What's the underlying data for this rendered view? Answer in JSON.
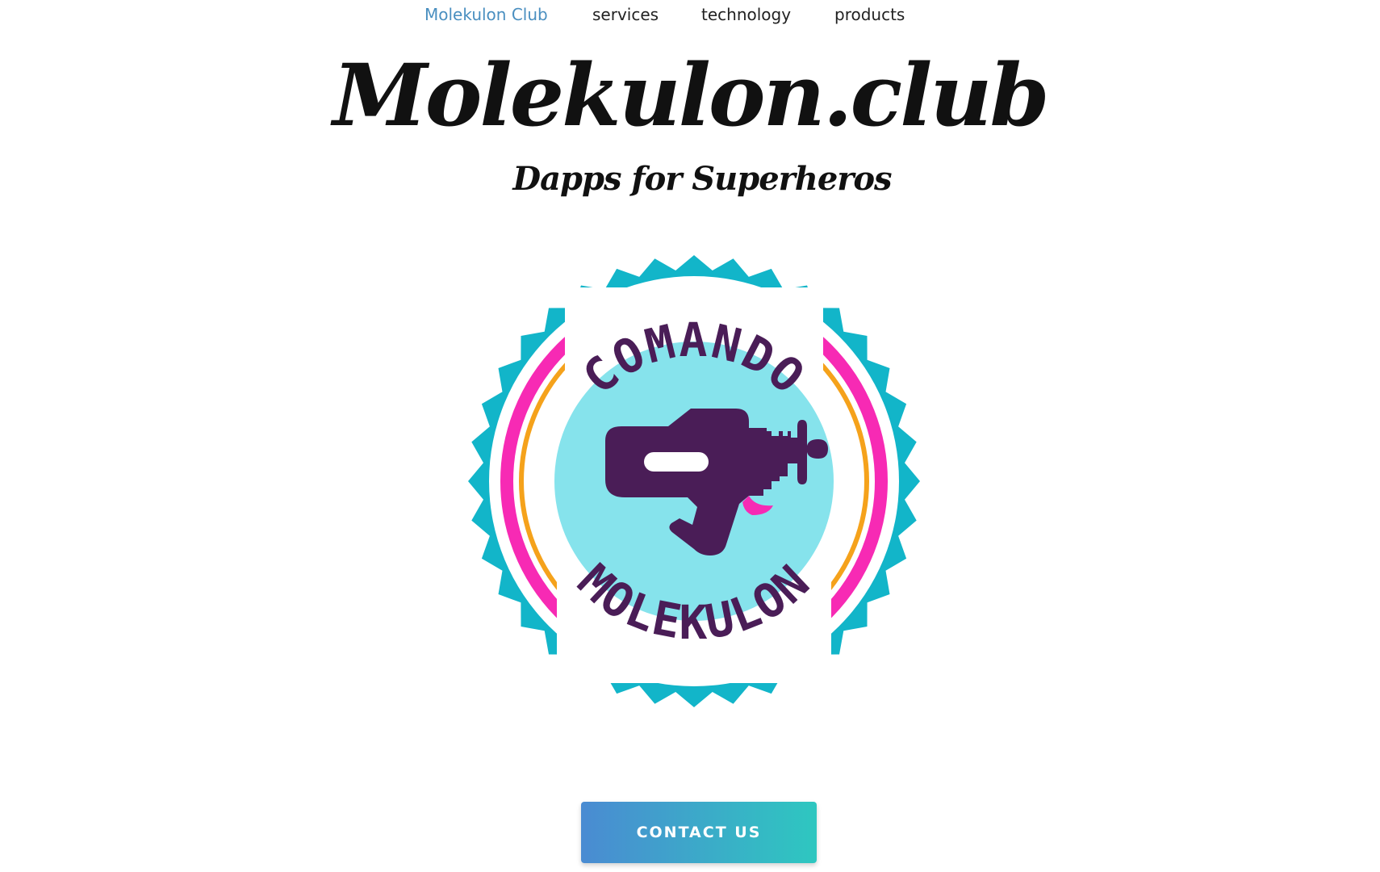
{
  "nav": {
    "items": [
      {
        "label": "Molekulon Club",
        "active": true
      },
      {
        "label": "services",
        "active": false
      },
      {
        "label": "technology",
        "active": false
      },
      {
        "label": "products",
        "active": false
      }
    ]
  },
  "hero": {
    "title": "Molekulon.club",
    "subtitle": "Dapps for Superheros"
  },
  "badge": {
    "top_text": "COMANDO",
    "bottom_text": "MOLEKULON",
    "icon": "ray-gun-icon"
  },
  "cta": {
    "label": "CONTACT US"
  },
  "colors": {
    "nav_active": "#4a8fc0",
    "badge_teal": "#12b5c9",
    "badge_pink": "#f72ab4",
    "badge_orange": "#f5a21b",
    "badge_purple": "#4a1d57",
    "badge_light_blue": "#86e3ec",
    "cta_gradient_start": "#4a8bd2",
    "cta_gradient_end": "#2ec7c0"
  }
}
